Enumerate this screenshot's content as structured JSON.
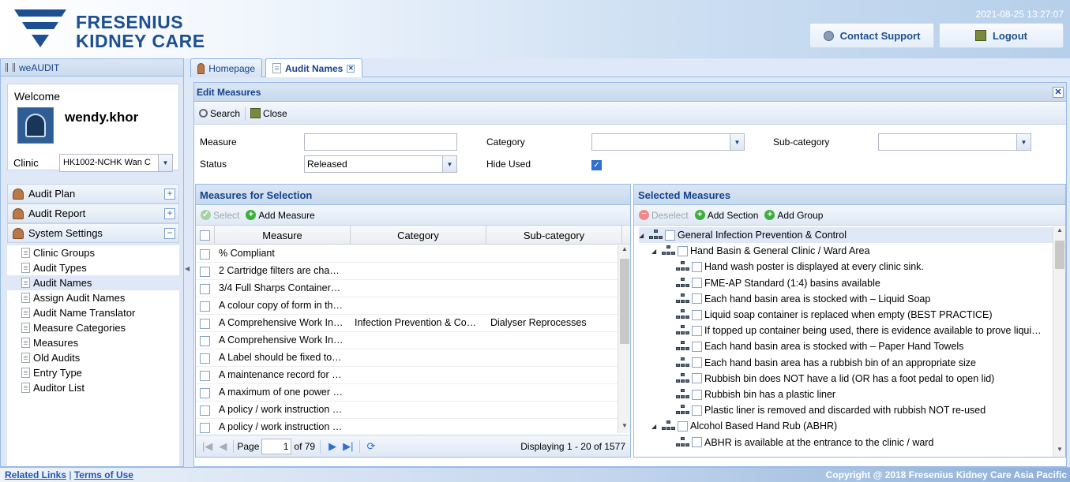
{
  "header": {
    "logo_line1": "FRESENIUS",
    "logo_line2": "KIDNEY CARE",
    "datetime": "2021-08-25 13:27:07",
    "contact_label": "Contact Support",
    "logout_label": "Logout"
  },
  "west": {
    "title": "weAUDIT",
    "welcome": "Welcome",
    "username": "wendy.khor",
    "clinic_label": "Clinic",
    "clinic_value": "HK1002-NCHK Wan C",
    "sections": [
      "Audit Plan",
      "Audit Report",
      "System Settings"
    ],
    "menu": [
      "Clinic Groups",
      "Audit Types",
      "Audit Names",
      "Assign Audit Names",
      "Audit Name Translator",
      "Measure Categories",
      "Measures",
      "Old Audits",
      "Entry Type",
      "Auditor List"
    ],
    "selected_menu": "Audit Names"
  },
  "tabs": {
    "home": "Homepage",
    "audit": "Audit Names"
  },
  "edit": {
    "title": "Edit Measures",
    "search": "Search",
    "close": "Close",
    "measure_label": "Measure",
    "category_label": "Category",
    "subcategory_label": "Sub-category",
    "status_label": "Status",
    "status_value": "Released",
    "hide_used_label": "Hide Used",
    "hide_used": true
  },
  "left_grid": {
    "title": "Measures for Selection",
    "select": "Select",
    "add_measure": "Add Measure",
    "columns": [
      "Measure",
      "Category",
      "Sub-category"
    ],
    "rows": [
      [
        "% Compliant",
        "",
        ""
      ],
      [
        "2 Cartridge filters are cha…",
        "",
        ""
      ],
      [
        "3/4 Full Sharps Container…",
        "",
        ""
      ],
      [
        "A colour copy of form in th…",
        "",
        ""
      ],
      [
        "A Comprehensive Work In…",
        "Infection Prevention & Co…",
        "Dialyser Reprocesses"
      ],
      [
        "A Comprehensive Work In…",
        "",
        ""
      ],
      [
        "A Label should be fixed to…",
        "",
        ""
      ],
      [
        "A maintenance record for …",
        "",
        ""
      ],
      [
        "A maximum of one power …",
        "",
        ""
      ],
      [
        "A policy / work instruction …",
        "",
        ""
      ],
      [
        "A policy / work instruction …",
        "",
        ""
      ]
    ],
    "pager": {
      "page_label": "Page",
      "page": "1",
      "of": "of 79",
      "display": "Displaying 1 - 20 of 1577"
    }
  },
  "right_tree": {
    "title": "Selected Measures",
    "deselect": "Deselect",
    "add_section": "Add Section",
    "add_group": "Add Group",
    "nodes": [
      {
        "level": 0,
        "text": "General Infection Prevention & Control",
        "expand": true
      },
      {
        "level": 1,
        "text": "Hand Basin & General Clinic / Ward Area",
        "expand": true
      },
      {
        "level": 2,
        "text": "Hand wash poster is displayed at every clinic sink."
      },
      {
        "level": 2,
        "text": "FME-AP Standard (1:4) basins available"
      },
      {
        "level": 2,
        "text": "Each hand basin area is stocked with – Liquid Soap"
      },
      {
        "level": 2,
        "text": "Liquid soap container is replaced when empty (BEST PRACTICE)"
      },
      {
        "level": 2,
        "text": "If topped up container being used, there is evidence available to prove liqui…"
      },
      {
        "level": 2,
        "text": "Each hand basin area is stocked with – Paper Hand Towels"
      },
      {
        "level": 2,
        "text": "Each hand basin area has a rubbish bin of an appropriate size"
      },
      {
        "level": 2,
        "text": "Rubbish bin does NOT have a lid (OR has a foot pedal to open lid)"
      },
      {
        "level": 2,
        "text": "Rubbish bin has a plastic liner"
      },
      {
        "level": 2,
        "text": "Plastic liner is removed and discarded with rubbish NOT re-used"
      },
      {
        "level": 1,
        "text": "Alcohol Based Hand Rub (ABHR)",
        "expand": true
      },
      {
        "level": 2,
        "text": "ABHR is available at the entrance to the clinic / ward"
      }
    ]
  },
  "footer": {
    "related": "Related Links",
    "sep": "|",
    "terms": "Terms of Use",
    "copyright": "Copyright @ 2018 Fresenius Kidney Care Asia Pacific"
  },
  "colors": {
    "brand": "#1d4f91",
    "panel_title": "#15428b",
    "border": "#99bbe8"
  }
}
